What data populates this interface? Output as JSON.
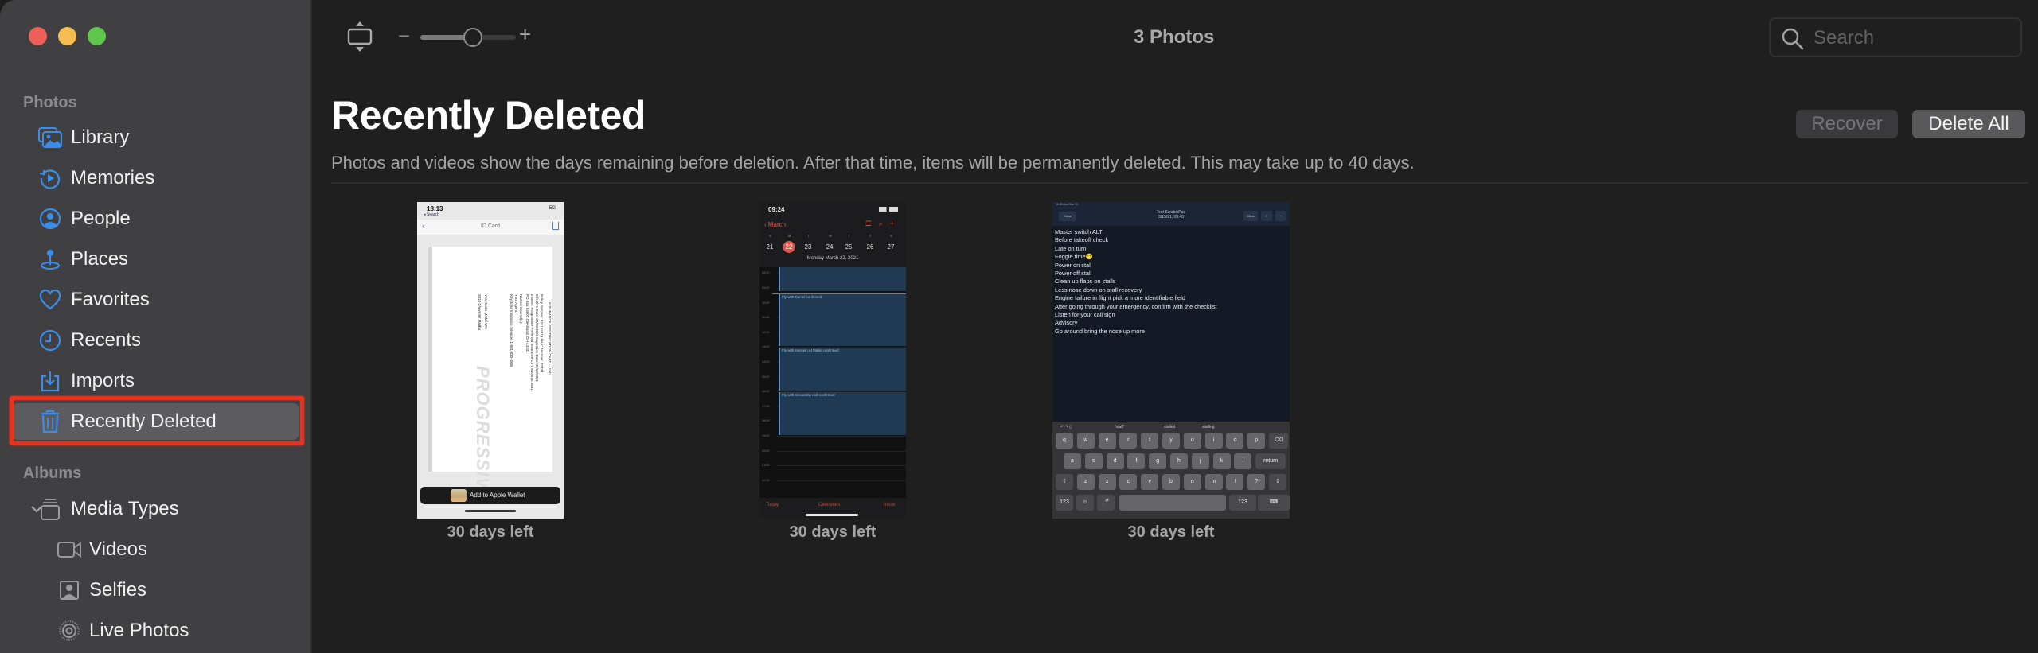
{
  "window": {
    "traffic_lights": {
      "close": "#ee5f5a",
      "minimize": "#f5bd4f",
      "zoom": "#5fc84c"
    }
  },
  "sidebar": {
    "sections": [
      {
        "label": "Photos",
        "items": [
          {
            "label": "Library",
            "icon": "library-icon"
          },
          {
            "label": "Memories",
            "icon": "memories-icon"
          },
          {
            "label": "People",
            "icon": "people-icon"
          },
          {
            "label": "Places",
            "icon": "places-icon"
          },
          {
            "label": "Favorites",
            "icon": "heart-icon"
          },
          {
            "label": "Recents",
            "icon": "clock-icon"
          },
          {
            "label": "Imports",
            "icon": "import-icon"
          },
          {
            "label": "Recently Deleted",
            "icon": "trash-icon",
            "selected": true
          }
        ]
      },
      {
        "label": "Albums",
        "items": [
          {
            "label": "Media Types",
            "icon": "album-stack-icon",
            "expanded": true
          },
          {
            "label": "Videos",
            "icon": "video-icon"
          },
          {
            "label": "Selfies",
            "icon": "selfie-icon"
          },
          {
            "label": "Live Photos",
            "icon": "live-photo-icon"
          }
        ]
      }
    ],
    "accent_color": "#3b8ee8",
    "annotation_color": "#e8321e"
  },
  "toolbar": {
    "zoom_minus": "−",
    "zoom_plus": "+",
    "zoom_level": 0.55,
    "photo_count": "3 Photos",
    "search_placeholder": "Search",
    "search_value": ""
  },
  "main": {
    "title": "Recently Deleted",
    "description": "Photos and videos show the days remaining before deletion. After that time, items will be permanently deleted. This may take up to 40 days.",
    "recover_label": "Recover",
    "delete_all_label": "Delete All",
    "photos": [
      {
        "caption": "30 days left",
        "kind": "screenshot-id-card",
        "status_time": "18:13",
        "status_back": "◂ Search",
        "status_right": "5G",
        "nav_title": "ID Card",
        "card_lines": [
          "INSURANCE IDENTIFICATION CARD - Utah",
          "Policy Number: 933164479     NAIC Number: 37834",
          "Effective Date: 03/18/2021   Expiration Date: 09/18/2021",
          "Insurer: Progressive Preferred Insurance Co 1 800 876 5581",
          "PO Box 94007 Cleveland, OH 44101",
          "Named Insured(s):",
          "Your Agent:",
          "Keystone Insurance Services 1-801-830-5555",
          "Year  Make          Model          VIN",
          "2010  Chevrolet     Malibu"
        ],
        "card_logo": "PROGRESSIVE",
        "wallet_button": "Add to Apple Wallet"
      },
      {
        "caption": "30 days left",
        "kind": "screenshot-calendar",
        "status_time": "09:24",
        "back_label": "March",
        "weekdays": [
          "S",
          "M",
          "T",
          "W",
          "T",
          "F",
          "S"
        ],
        "days": [
          "21",
          "22",
          "23",
          "24",
          "25",
          "26",
          "27"
        ],
        "today_index": 1,
        "date_line": "Monday   March 22, 2021",
        "hours": [
          "08:00",
          "09:00",
          "10:00",
          "11:00",
          "12:00",
          "13:00",
          "14:00",
          "15:00",
          "16:00",
          "17:00",
          "18:00",
          "19:00",
          "20:00",
          "21:00",
          "22:00"
        ],
        "now_label": "09:24",
        "events": [
          {
            "title": "Fly with Daniel confirmed",
            "start": 9.4,
            "end": 13.0
          },
          {
            "title": "Fly with Hussein Al Maliki confirmed",
            "start": 13.0,
            "end": 16.0
          },
          {
            "title": "Fly with Alexandra Hall confirmed",
            "start": 16.0,
            "end": 19.0
          }
        ],
        "prev_event_end": 9.2,
        "tabs": [
          "Today",
          "Calendars",
          "Inbox"
        ]
      },
      {
        "caption": "30 days left",
        "kind": "screenshot-scratchpad",
        "status": "11:33  Mon Mar 15",
        "close_label": "Close",
        "title": "Text ScratchPad",
        "subtitle": "3/15/21, 09:48",
        "clear_label": "Clear",
        "notes": [
          "Master switch ALT",
          "Before takeoff check",
          "Late on turn",
          "Foggle time😬",
          "Power on stall",
          "Power off stall",
          "Clean up flaps on stalls",
          "Less nose down on stall recovery",
          "Engine failure in flight pick a more identifiable field",
          "After going through your emergency, confirm with the checklist",
          "Listen for your call sign",
          "Advisory",
          "Go around bring the nose up more"
        ],
        "suggestions": [
          "\"stall\"",
          "stalled",
          "stalling"
        ],
        "keyboard_rows": [
          [
            "q",
            "w",
            "e",
            "r",
            "t",
            "y",
            "u",
            "i",
            "o",
            "p",
            "⌫"
          ],
          [
            "a",
            "s",
            "d",
            "f",
            "g",
            "h",
            "j",
            "k",
            "l",
            "return"
          ],
          [
            "⇧",
            "z",
            "x",
            "c",
            "v",
            "b",
            "n",
            "m",
            "!",
            "?",
            "⇧"
          ],
          [
            "123",
            "☺",
            "🎤",
            "",
            "123",
            "⌨"
          ]
        ]
      }
    ]
  }
}
